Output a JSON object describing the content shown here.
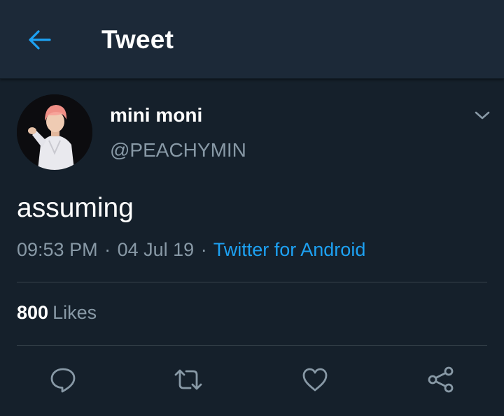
{
  "header": {
    "title": "Tweet",
    "back_icon": "arrow-left-icon",
    "accent_color": "#1da1f2"
  },
  "tweet": {
    "author": {
      "display_name": "mini moni",
      "handle": "@PEACHYMIN",
      "avatar": "profile-photo"
    },
    "menu_icon": "chevron-down-icon",
    "text": "assuming",
    "time": "09:53 PM",
    "date": "04 Jul 19",
    "separator": "·",
    "source": "Twitter for Android",
    "likes": {
      "count": "800",
      "label": "Likes"
    },
    "actions": [
      {
        "name": "reply",
        "icon": "comment-icon"
      },
      {
        "name": "retweet",
        "icon": "retweet-icon"
      },
      {
        "name": "like",
        "icon": "heart-icon"
      },
      {
        "name": "share",
        "icon": "share-icon"
      }
    ]
  },
  "colors": {
    "background": "#15202b",
    "header_background": "#1c2938",
    "secondary_text": "#8899a6",
    "divider": "#38444d"
  }
}
